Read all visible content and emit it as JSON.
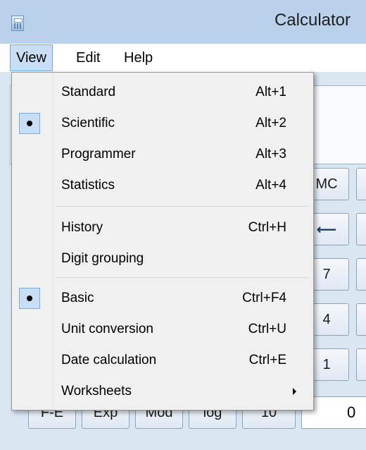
{
  "window": {
    "title": "Calculator"
  },
  "menubar": {
    "items": [
      "View",
      "Edit",
      "Help"
    ]
  },
  "calculator": {
    "buttons": {
      "mc": "MC",
      "backspace": "⟵",
      "seven": "7",
      "four": "4",
      "one": "1",
      "fe": "F-E",
      "exp": "Exp",
      "mod": "Mod",
      "log": "log",
      "ten_x": "10",
      "field_value": "0"
    }
  },
  "view_menu": {
    "items": [
      {
        "label": "Standard",
        "shortcut": "Alt+1",
        "checked": false
      },
      {
        "label": "Scientific",
        "shortcut": "Alt+2",
        "checked": true
      },
      {
        "label": "Programmer",
        "shortcut": "Alt+3",
        "checked": false
      },
      {
        "label": "Statistics",
        "shortcut": "Alt+4",
        "checked": false
      },
      {
        "label": "History",
        "shortcut": "Ctrl+H",
        "checked": false
      },
      {
        "label": "Digit grouping",
        "shortcut": "",
        "checked": false
      },
      {
        "label": "Basic",
        "shortcut": "Ctrl+F4",
        "checked": true
      },
      {
        "label": "Unit conversion",
        "shortcut": "Ctrl+U",
        "checked": false
      },
      {
        "label": "Date calculation",
        "shortcut": "Ctrl+E",
        "checked": false
      },
      {
        "label": "Worksheets",
        "shortcut": "",
        "checked": false,
        "submenu": true
      }
    ]
  },
  "colors": {
    "titlebar": "#b9d1ea",
    "menu_highlight": "#c9def5",
    "menu_background": "#f0f0f0"
  }
}
